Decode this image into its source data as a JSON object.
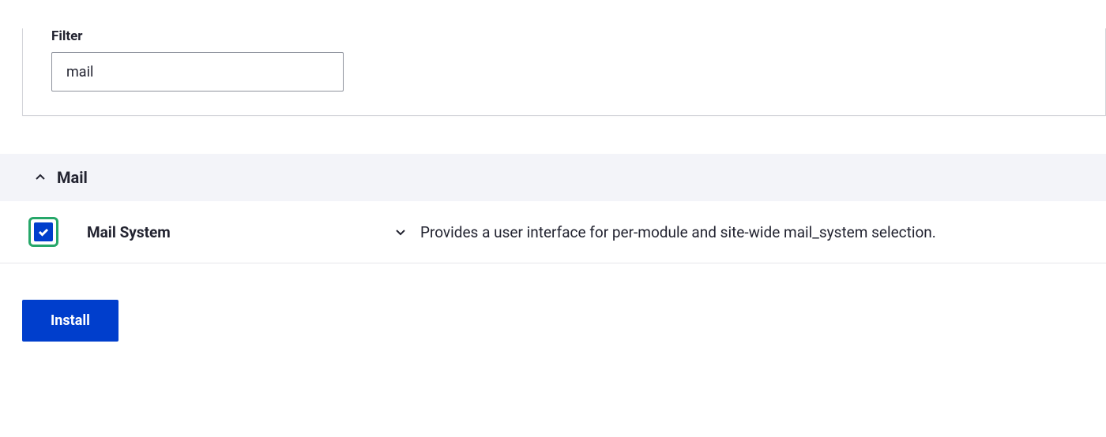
{
  "filter": {
    "label": "Filter",
    "value": "mail"
  },
  "category": {
    "title": "Mail"
  },
  "modules": [
    {
      "name": "Mail System",
      "description": "Provides a user interface for per-module and site-wide mail_system selection.",
      "checked": true
    }
  ],
  "actions": {
    "install_label": "Install"
  }
}
